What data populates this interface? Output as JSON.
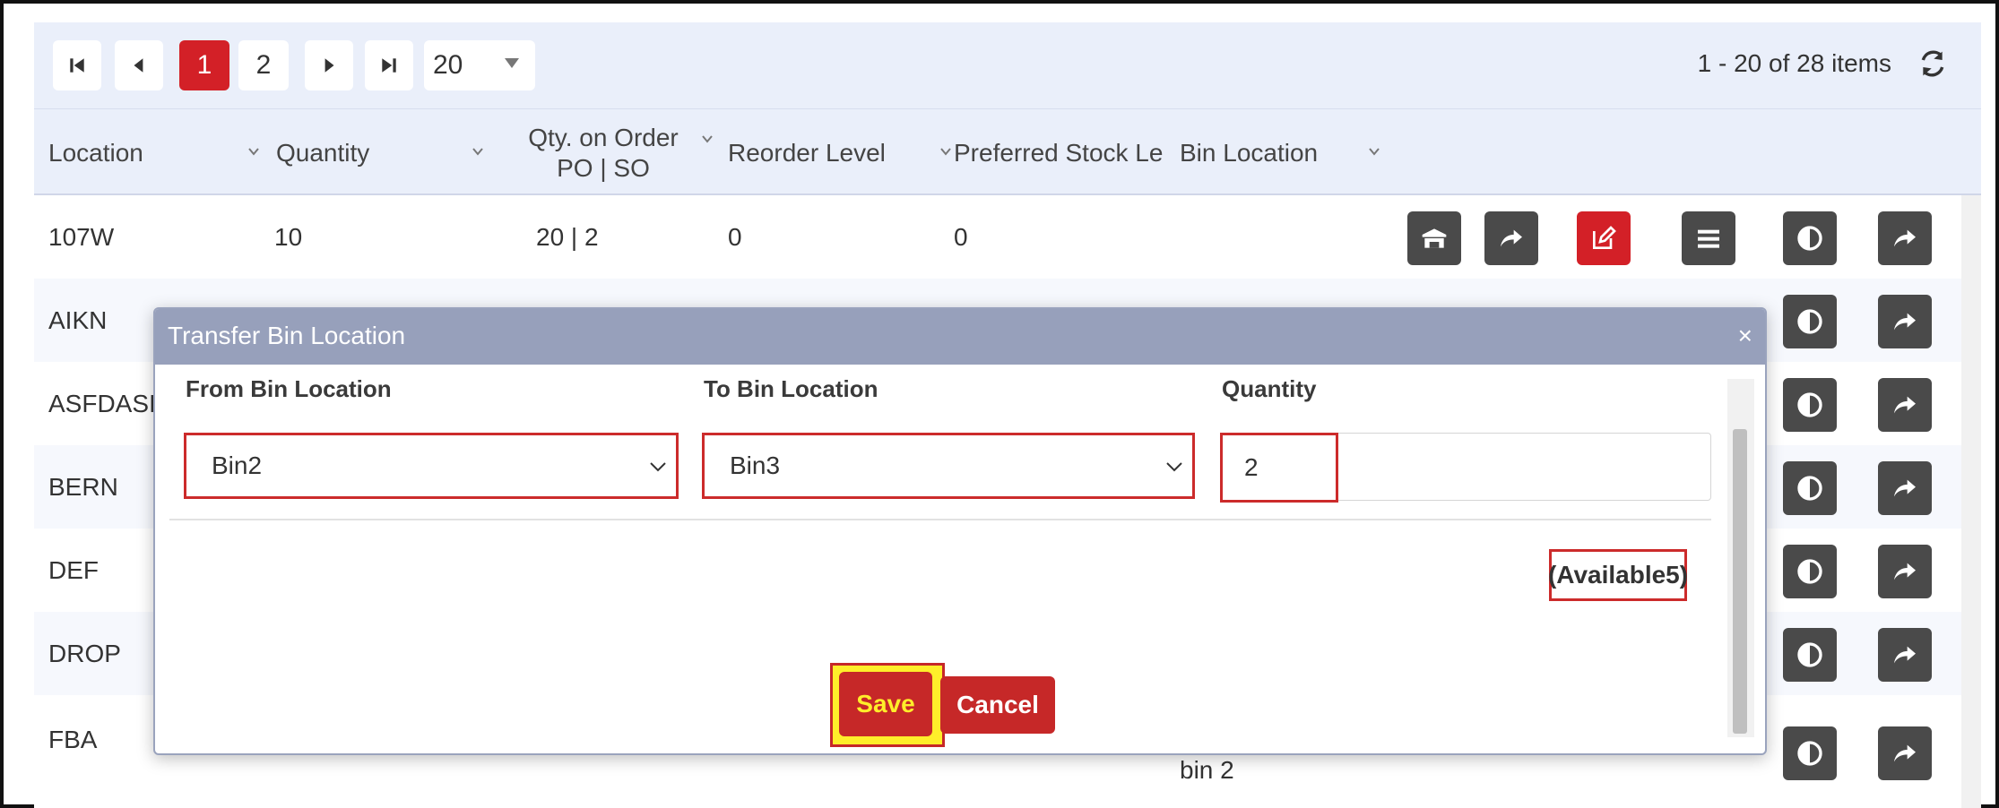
{
  "pager": {
    "pages": [
      "1",
      "2"
    ],
    "active_page": "1",
    "page_size": "20",
    "info": "1 - 20 of 28 items"
  },
  "columns": [
    {
      "label": "Location"
    },
    {
      "label": "Quantity"
    },
    {
      "label": "Qty. on Order",
      "sub": "PO | SO"
    },
    {
      "label": "Reorder Level"
    },
    {
      "label": "Preferred Stock Le"
    },
    {
      "label": "Bin Location"
    }
  ],
  "rows": [
    {
      "location": "107W",
      "quantity": "10",
      "qty_on_order": "20 | 2",
      "reorder_level": "0",
      "preferred_stock": "0",
      "bin_location": ""
    },
    {
      "location": "AIKN",
      "quantity": "",
      "qty_on_order": "",
      "reorder_level": "",
      "preferred_stock": "",
      "bin_location": ""
    },
    {
      "location": "ASFDASI",
      "quantity": "",
      "qty_on_order": "",
      "reorder_level": "",
      "preferred_stock": "",
      "bin_location": ""
    },
    {
      "location": "BERN",
      "quantity": "",
      "qty_on_order": "",
      "reorder_level": "",
      "preferred_stock": "",
      "bin_location": ""
    },
    {
      "location": "DEF",
      "quantity": "",
      "qty_on_order": "",
      "reorder_level": "",
      "preferred_stock": "",
      "bin_location": ""
    },
    {
      "location": "DROP",
      "quantity": "",
      "qty_on_order": "",
      "reorder_level": "",
      "preferred_stock": "",
      "bin_location": ""
    },
    {
      "location": "FBA",
      "quantity": "",
      "qty_on_order": "",
      "reorder_level": "",
      "preferred_stock": "",
      "bin_location": "bin 2"
    }
  ],
  "modal": {
    "title": "Transfer Bin Location",
    "close": "×",
    "from_label": "From Bin Location",
    "to_label": "To Bin Location",
    "qty_label": "Quantity",
    "from_value": "Bin2",
    "to_value": "Bin3",
    "qty_value": "2",
    "available": "(Available5)",
    "save_label": "Save",
    "cancel_label": "Cancel"
  },
  "colors": {
    "accent_red": "#d32027",
    "header_bg": "#eaeffa",
    "modal_header": "#97a0bb",
    "save_text": "#ffee2a"
  },
  "icons": [
    "first-page-icon",
    "prev-page-icon",
    "next-page-icon",
    "last-page-icon",
    "refresh-icon",
    "warehouse-icon",
    "share-icon",
    "edit-icon",
    "menu-icon",
    "contrast-icon",
    "forward-icon",
    "chevron-down-icon"
  ]
}
